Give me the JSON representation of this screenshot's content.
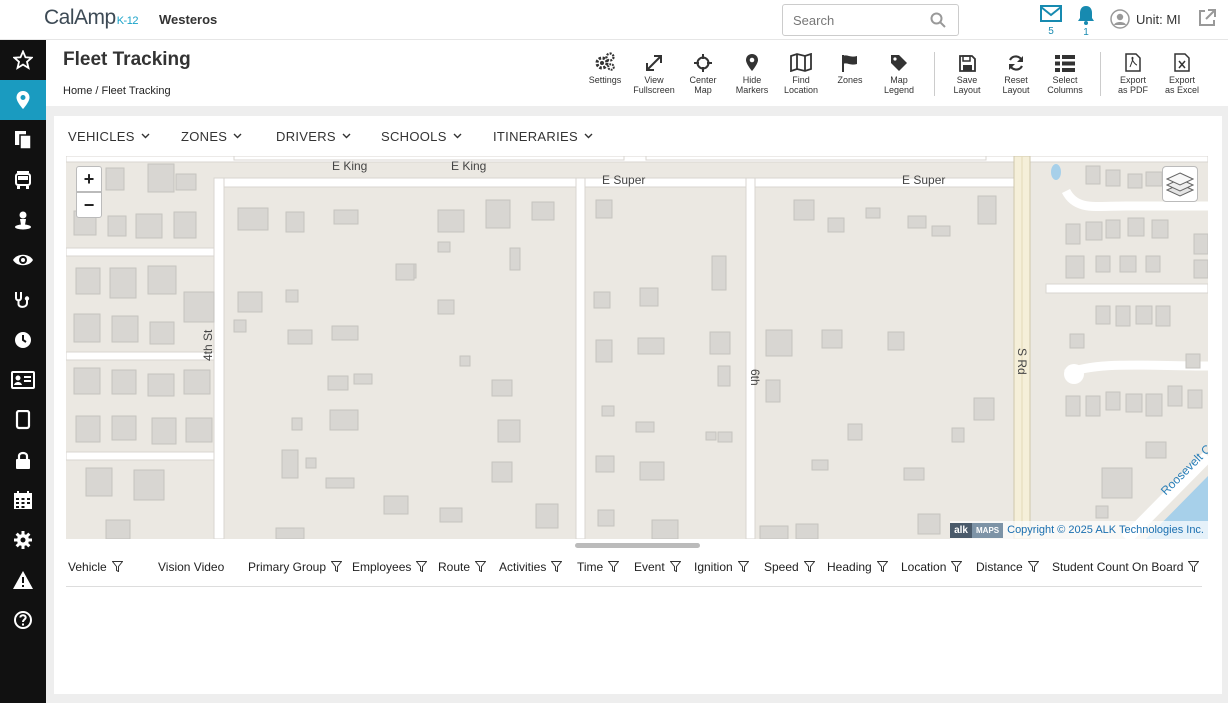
{
  "app": {
    "logo_text": "CalAmp",
    "logo_suffix": "K-12",
    "district": "Westeros"
  },
  "search": {
    "placeholder": "Search"
  },
  "header_icons": {
    "messages_count": "5",
    "alerts_count": "1",
    "user_label": "Unit: MI"
  },
  "page": {
    "title": "Fleet Tracking",
    "breadcrumb": "Home / Fleet Tracking"
  },
  "toolbar": [
    {
      "label1": "Settings",
      "label2": "",
      "icon": "gears-icon"
    },
    {
      "label1": "View",
      "label2": "Fullscreen",
      "icon": "expand-icon"
    },
    {
      "label1": "Center",
      "label2": "Map",
      "icon": "crosshair-icon"
    },
    {
      "label1": "Hide",
      "label2": "Markers",
      "icon": "map-marker-icon"
    },
    {
      "label1": "Find",
      "label2": "Location",
      "icon": "map-icon"
    },
    {
      "label1": "Zones",
      "label2": "",
      "icon": "flag-icon"
    },
    {
      "label1": "Map",
      "label2": "Legend",
      "icon": "tag-icon"
    },
    {
      "label1": "Save",
      "label2": "Layout",
      "icon": "save-icon"
    },
    {
      "label1": "Reset",
      "label2": "Layout",
      "icon": "refresh-icon"
    },
    {
      "label1": "Select",
      "label2": "Columns",
      "icon": "list-icon"
    },
    {
      "label1": "Export",
      "label2": "as PDF",
      "icon": "pdf-icon"
    },
    {
      "label1": "Export",
      "label2": "as Excel",
      "icon": "excel-icon"
    }
  ],
  "filters": [
    "VEHICLES",
    "ZONES",
    "DRIVERS",
    "SCHOOLS",
    "ITINERARIES"
  ],
  "map": {
    "zoom_in": "+",
    "zoom_out": "−",
    "streets": [
      "E King",
      "E King",
      "E Super",
      "E Super",
      "4th St",
      "6th",
      "S Rd",
      "Roosevelt Ca"
    ],
    "copyright_brand": "alk",
    "copyright_maps": "MAPS",
    "copyright_text": "Copyright © 2025 ALK Technologies Inc."
  },
  "grid": {
    "columns": [
      "Vehicle",
      "Vision Video",
      "Primary Group",
      "Employees",
      "Route",
      "Activities",
      "Time",
      "Event",
      "Ignition",
      "Speed",
      "Heading",
      "Location",
      "Distance",
      "Student Count On Board"
    ]
  },
  "colors": {
    "accent": "#1a9bc0",
    "sidebar": "#111111",
    "map_bg": "#ebe8e2"
  }
}
